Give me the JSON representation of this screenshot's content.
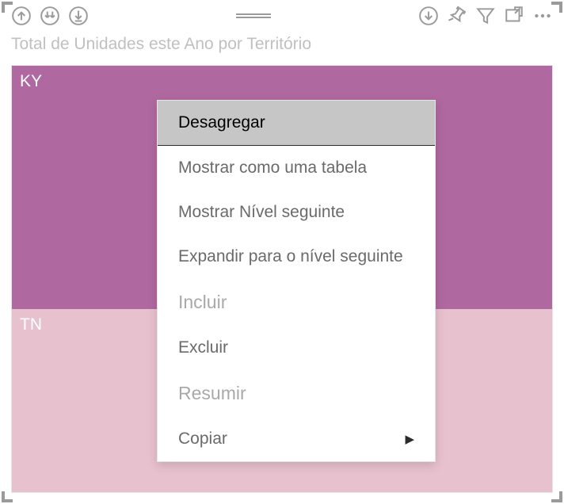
{
  "toolbar": {
    "icons": {
      "drill_up": "drill-up-icon",
      "drill_down_all": "drill-down-all-icon",
      "expand_hierarchy": "expand-hierarchy-icon",
      "drag_handle": "drag-handle-icon",
      "drill_down_single": "drill-down-single-icon",
      "pin": "pin-icon",
      "filter": "filter-icon",
      "focus_mode": "focus-mode-icon",
      "more": "more-options-icon"
    }
  },
  "visual": {
    "title": "Total de Unidades este Ano por Território"
  },
  "chart_data": {
    "type": "treemap",
    "title": "Total de Unidades este Ano por Território",
    "tiles": [
      {
        "label": "KY",
        "color": "#b069a0",
        "proportion": 0.57
      },
      {
        "label": "TN",
        "color": "#e8c1ce",
        "proportion": 0.43
      }
    ]
  },
  "context_menu": {
    "items": [
      {
        "label": "Desagregar",
        "highlighted": true
      },
      {
        "label": "Mostrar como uma tabela"
      },
      {
        "label": "Mostrar Nível seguinte"
      },
      {
        "label": "Expandir para o nível seguinte"
      },
      {
        "label": "Incluir",
        "faded": true
      },
      {
        "label": "Excluir"
      },
      {
        "label": "Resumir",
        "faded": true
      },
      {
        "label": "Copiar",
        "has_submenu": true
      }
    ]
  }
}
